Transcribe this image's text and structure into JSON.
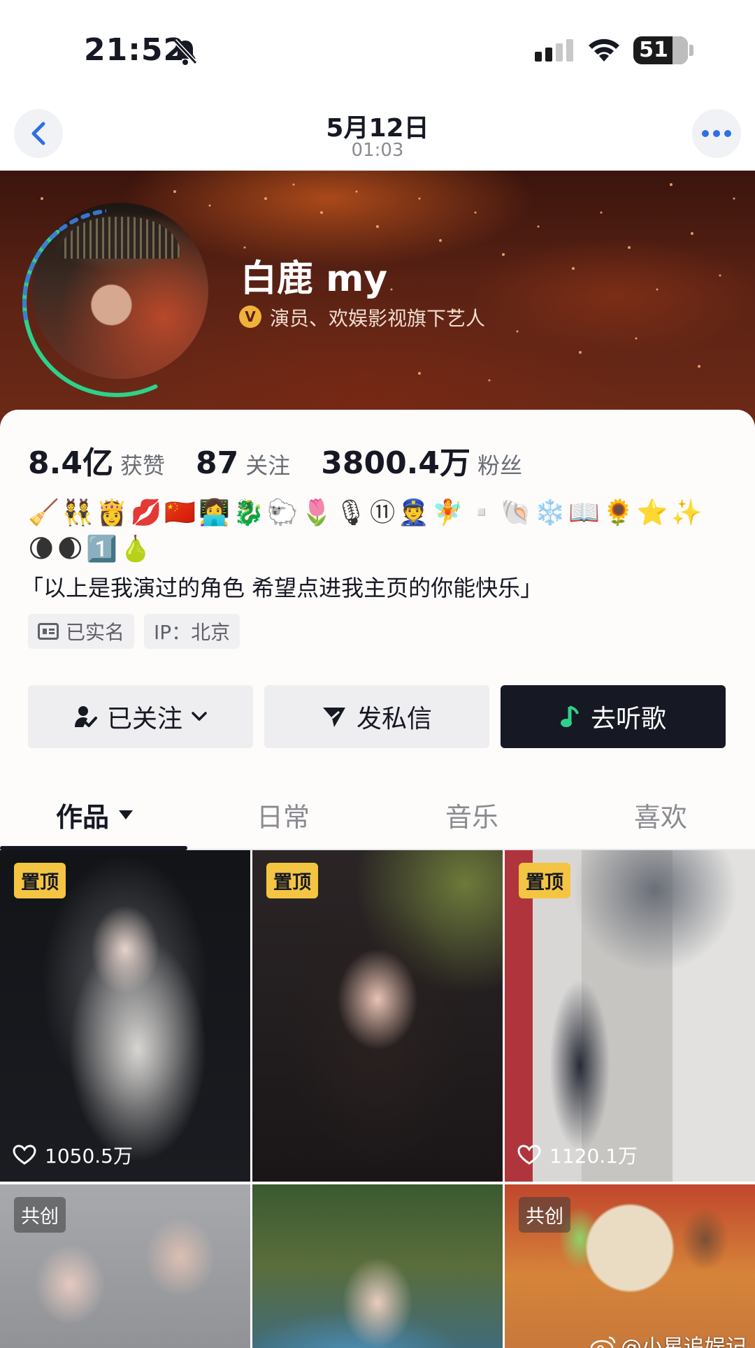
{
  "status_bar": {
    "time": "21:52",
    "battery": "51"
  },
  "nav": {
    "date": "5月12日",
    "time": "01:03"
  },
  "profile": {
    "name": "白鹿 my",
    "verification": "演员、欢娱影视旗下艺人",
    "verify_mark": "V",
    "stats": [
      {
        "value": "8.4亿",
        "label": "获赞"
      },
      {
        "value": "87",
        "label": "关注"
      },
      {
        "value": "3800.4万",
        "label": "粉丝"
      }
    ],
    "emoji_line_1": "🧹👯👸💋🇨🇳👩‍💻🐉🐑🌷🎙⑪👮🧚▫️🐚❄️📖🌻⭐✨",
    "emoji_line_2": "🌘🌒1️⃣🍐",
    "bio": "「以上是我演过的角色 希望点进我主页的你能快乐」",
    "tags": {
      "real_name": "已实名",
      "ip": "IP：北京"
    }
  },
  "actions": {
    "follow": "已关注",
    "message": "发私信",
    "music": "去听歌"
  },
  "tabs": [
    {
      "label": "作品",
      "active": true
    },
    {
      "label": "日常",
      "active": false
    },
    {
      "label": "音乐",
      "active": false
    },
    {
      "label": "喜欢",
      "active": false
    }
  ],
  "grid": {
    "items": [
      {
        "badge": "置顶",
        "likes": "1050.5万"
      },
      {
        "badge": "置顶",
        "likes": ""
      },
      {
        "badge": "置顶",
        "likes": "1120.1万"
      },
      {
        "badge": "共创"
      },
      {
        "badge": ""
      },
      {
        "badge": "共创"
      }
    ]
  },
  "watermark": "@小星追娱记",
  "colors": {
    "accent_dark": "#161823",
    "pin_yellow": "#f4c542",
    "ring_blue": "#3a7bd5",
    "ring_green": "#2fd18a"
  }
}
